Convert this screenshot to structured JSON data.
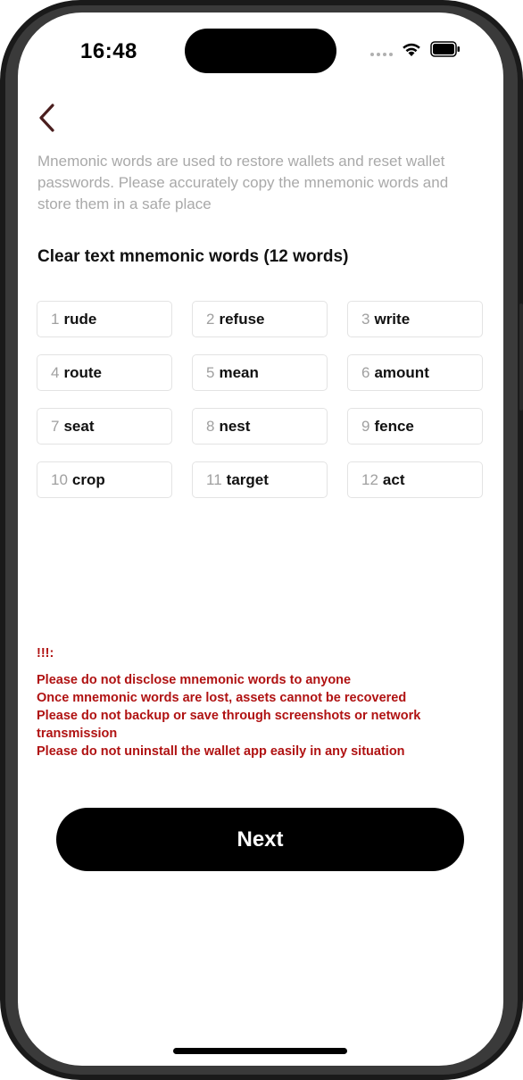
{
  "status_bar": {
    "time": "16:48"
  },
  "intro": "Mnemonic words are used to restore wallets and reset wallet passwords. Please accurately copy the mnemonic words and store them in a safe place",
  "section_title": "Clear text mnemonic words (12 words)",
  "words": [
    {
      "num": "1",
      "word": "rude"
    },
    {
      "num": "2",
      "word": "refuse"
    },
    {
      "num": "3",
      "word": "write"
    },
    {
      "num": "4",
      "word": "route"
    },
    {
      "num": "5",
      "word": "mean"
    },
    {
      "num": "6",
      "word": "amount"
    },
    {
      "num": "7",
      "word": "seat"
    },
    {
      "num": "8",
      "word": "nest"
    },
    {
      "num": "9",
      "word": "fence"
    },
    {
      "num": "10",
      "word": "crop"
    },
    {
      "num": "11",
      "word": "target"
    },
    {
      "num": "12",
      "word": "act"
    }
  ],
  "warning": {
    "title": "!!!:",
    "lines": [
      "Please do not disclose mnemonic words to anyone",
      "Once mnemonic words are lost, assets cannot be recovered",
      "Please do not backup or save through screenshots or network transmission",
      "Please do not uninstall the wallet app easily in any situation"
    ]
  },
  "next_label": "Next",
  "colors": {
    "warning": "#b01212",
    "muted": "#a9a9a9",
    "button": "#000000"
  },
  "icons": {
    "back": "chevron-left-icon",
    "wifi": "wifi-icon",
    "battery": "battery-icon",
    "signal": "signal-icon"
  }
}
